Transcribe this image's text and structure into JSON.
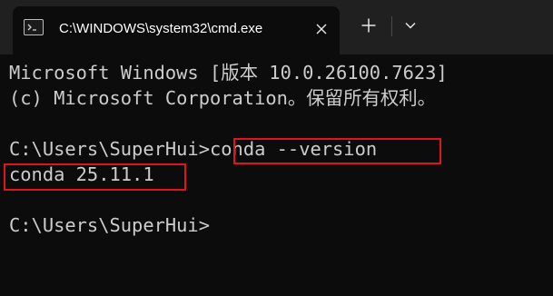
{
  "tab": {
    "title": "C:\\WINDOWS\\system32\\cmd.exe",
    "icon": "cmd-icon"
  },
  "toolbar": {
    "close_icon": "close-icon",
    "new_tab_icon": "plus-icon",
    "dropdown_icon": "chevron-down-icon"
  },
  "terminal": {
    "lines": [
      "Microsoft Windows [版本 10.0.26100.7623]",
      "(c) Microsoft Corporation。保留所有权利。",
      "",
      "C:\\Users\\SuperHui>",
      "conda 25.11.1",
      "",
      "C:\\Users\\SuperHui>"
    ],
    "command": "conda --version",
    "highlight_color": "#e0141e",
    "text_color": "#cccccc",
    "background_color": "#0c0c0c"
  }
}
